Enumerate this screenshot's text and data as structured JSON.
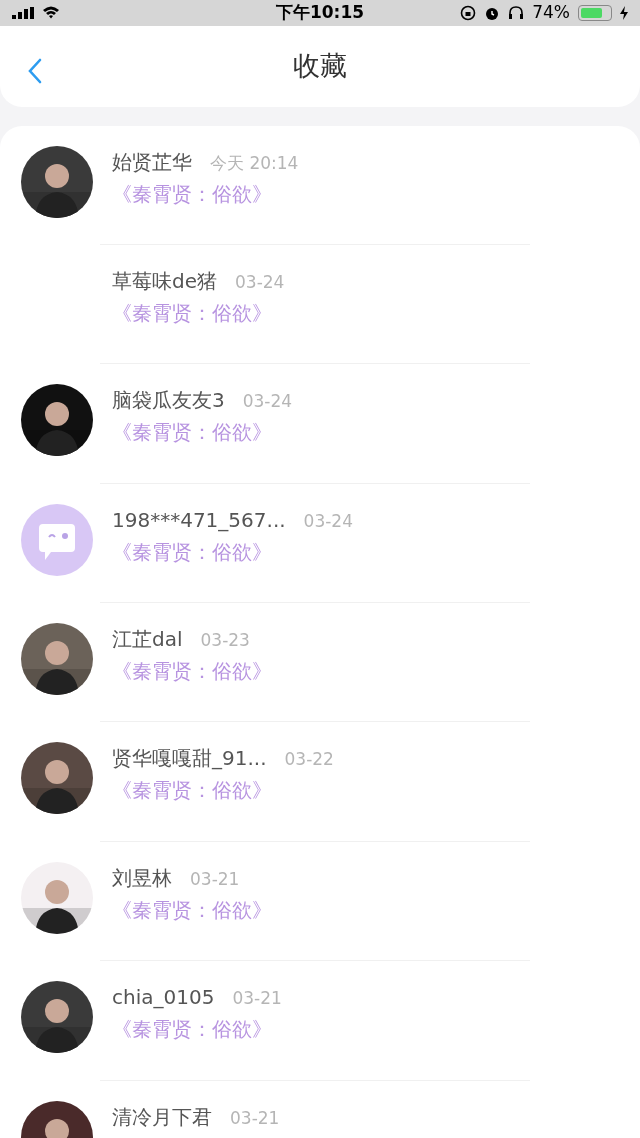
{
  "status_bar": {
    "time": "下午10:15",
    "battery": "74%"
  },
  "header": {
    "title": "收藏"
  },
  "items": [
    {
      "name": "始贤芷华",
      "time": "今天 20:14",
      "work": "《秦霄贤：俗欲》"
    },
    {
      "name": "草莓味de猪",
      "time": "03-24",
      "work": "《秦霄贤：俗欲》",
      "kind": "blank"
    },
    {
      "name": "脑袋瓜友友3",
      "time": "03-24",
      "work": "《秦霄贤：俗欲》"
    },
    {
      "name": "198***471_567...",
      "time": "03-24",
      "work": "《秦霄贤：俗欲》",
      "kind": "default"
    },
    {
      "name": "江芷dal",
      "time": "03-23",
      "work": "《秦霄贤：俗欲》"
    },
    {
      "name": "贤华嘎嘎甜_91...",
      "time": "03-22",
      "work": "《秦霄贤：俗欲》"
    },
    {
      "name": "刘昱林",
      "time": "03-21",
      "work": "《秦霄贤：俗欲》"
    },
    {
      "name": "chia_0105",
      "time": "03-21",
      "work": "《秦霄贤：俗欲》"
    },
    {
      "name": "清冷月下君",
      "time": "03-21"
    }
  ]
}
